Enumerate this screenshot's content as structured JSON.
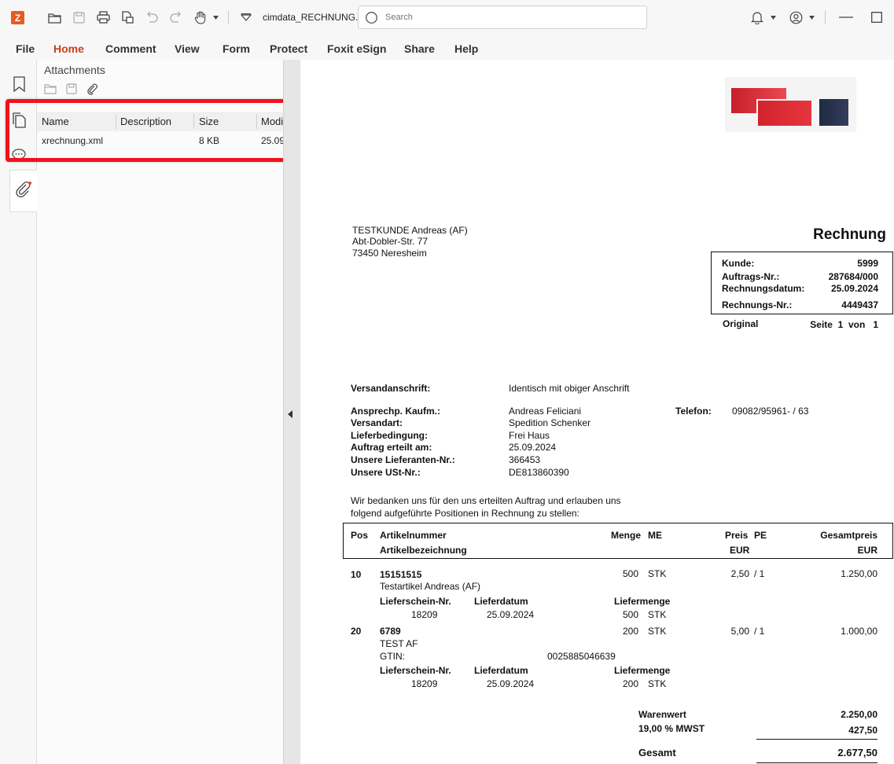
{
  "titlebar": {
    "app_logo": "Z",
    "doc_title": "cimdata_RECHNUNG...",
    "search_placeholder": "Search",
    "icons": [
      "open-folder-icon",
      "save-icon",
      "print-icon",
      "copy-file-icon",
      "undo-icon",
      "redo-icon",
      "hand-icon",
      "quick-access-dropdown-icon",
      "bell-icon",
      "user-icon",
      "minimize-icon",
      "maximize-icon"
    ]
  },
  "menu": {
    "items": [
      "File",
      "Home",
      "Comment",
      "View",
      "Form",
      "Protect",
      "Foxit eSign",
      "Share",
      "Help"
    ],
    "active": "Home"
  },
  "attachments_panel": {
    "title": "Attachments",
    "columns": [
      "Name",
      "Description",
      "Size",
      "Modi"
    ],
    "rows": [
      {
        "name": "xrechnung.xml",
        "description": "",
        "size": "8 KB",
        "modified": "25.09"
      }
    ]
  },
  "document": {
    "customer": [
      "TESTKUNDE Andreas (AF)",
      "Abt-Dobler-Str. 77",
      "73450 Neresheim"
    ],
    "doc_title": "Rechnung",
    "info": {
      "kunde_label": "Kunde:",
      "kunde_value": "5999",
      "auftrag_label": "Auftrags-Nr.:",
      "auftrag_value": "287684/000",
      "datum_label": "Rechnungsdatum:",
      "datum_value": "25.09.2024",
      "rnr_label": "Rechnungs-Nr.:",
      "rnr_value": "4449437"
    },
    "original": "Original",
    "seite": "Seite  1  von   1",
    "versand_label": "Versandanschrift:",
    "versand_value": "Identisch mit obiger Anschrift",
    "details_labels": [
      "Ansprechp. Kaufm.:",
      "Versandart:",
      "Lieferbedingung:",
      "Auftrag erteilt am:",
      "Unsere Lieferanten-Nr.:",
      "Unsere USt-Nr.:"
    ],
    "details_values": [
      "Andreas Feliciani",
      "Spedition Schenker",
      "Frei Haus",
      "25.09.2024",
      "366453",
      "DE813860390"
    ],
    "telefon_label": "Telefon:",
    "telefon_value": "09082/95961- / 63",
    "intro": [
      "Wir bedanken uns für den uns erteilten Auftrag und erlauben uns",
      "folgend aufgeführte Positionen in Rechnung zu stellen:"
    ],
    "table_header": {
      "pos": "Pos",
      "artikelnummer": "Artikelnummer",
      "artikelbezeichnung": "Artikelbezeichnung",
      "menge": "Menge",
      "me": "ME",
      "preis": "Preis",
      "pe": "PE",
      "eur1": "EUR",
      "gesamtpreis": "Gesamtpreis",
      "eur2": "EUR"
    },
    "positions": [
      {
        "pos": "10",
        "artikel": "15151515",
        "bezeichnung": "Testartikel Andreas (AF)",
        "gtin_label": "",
        "gtin": "",
        "menge": "500",
        "me": "STK",
        "preis": "2,50",
        "pe": "/ 1",
        "gesamt": "1.250,00",
        "ls_label": "Lieferschein-Nr.",
        "ld_label": "Lieferdatum",
        "lm_label": "Liefermenge",
        "ls": "18209",
        "ld": "25.09.2024",
        "lm": "500",
        "lm_me": "STK"
      },
      {
        "pos": "20",
        "artikel": "6789",
        "bezeichnung": "TEST AF",
        "gtin_label": "GTIN:",
        "gtin": "0025885046639",
        "menge": "200",
        "me": "STK",
        "preis": "5,00",
        "pe": "/ 1",
        "gesamt": "1.000,00",
        "ls_label": "Lieferschein-Nr.",
        "ld_label": "Lieferdatum",
        "lm_label": "Liefermenge",
        "ls": "18209",
        "ld": "25.09.2024",
        "lm": "200",
        "lm_me": "STK"
      }
    ],
    "totals": {
      "warenwert_label": "Warenwert",
      "warenwert": "2.250,00",
      "mwst_label": "19,00 % MWST",
      "mwst": "427,50",
      "gesamt_label": "Gesamt",
      "gesamt": "2.677,50"
    }
  }
}
